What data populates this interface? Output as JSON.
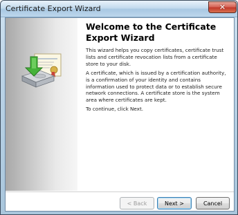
{
  "window": {
    "title": "Certificate Export Wizard",
    "close_glyph": "✕"
  },
  "content": {
    "heading": "Welcome to the Certificate Export Wizard",
    "paragraph1": "This wizard helps you copy certificates, certificate trust lists and certificate revocation lists from a certificate store to your disk.",
    "paragraph2": "A certificate, which is issued by a certification authority, is a confirmation of your identity and contains information used to protect data or to establish secure network connections. A certificate store is the system area where certificates are kept.",
    "paragraph3": "To continue, click Next."
  },
  "buttons": {
    "back": "< Back",
    "next": "Next >",
    "cancel": "Cancel"
  },
  "icons": {
    "wizard": "certificate-export-icon",
    "close": "close-icon"
  },
  "colors": {
    "side_panel_dark": "#a8a8a8",
    "side_panel_light": "#f6f6f6",
    "close_button": "#c23a2c",
    "next_button_border": "#3c7fb1"
  }
}
